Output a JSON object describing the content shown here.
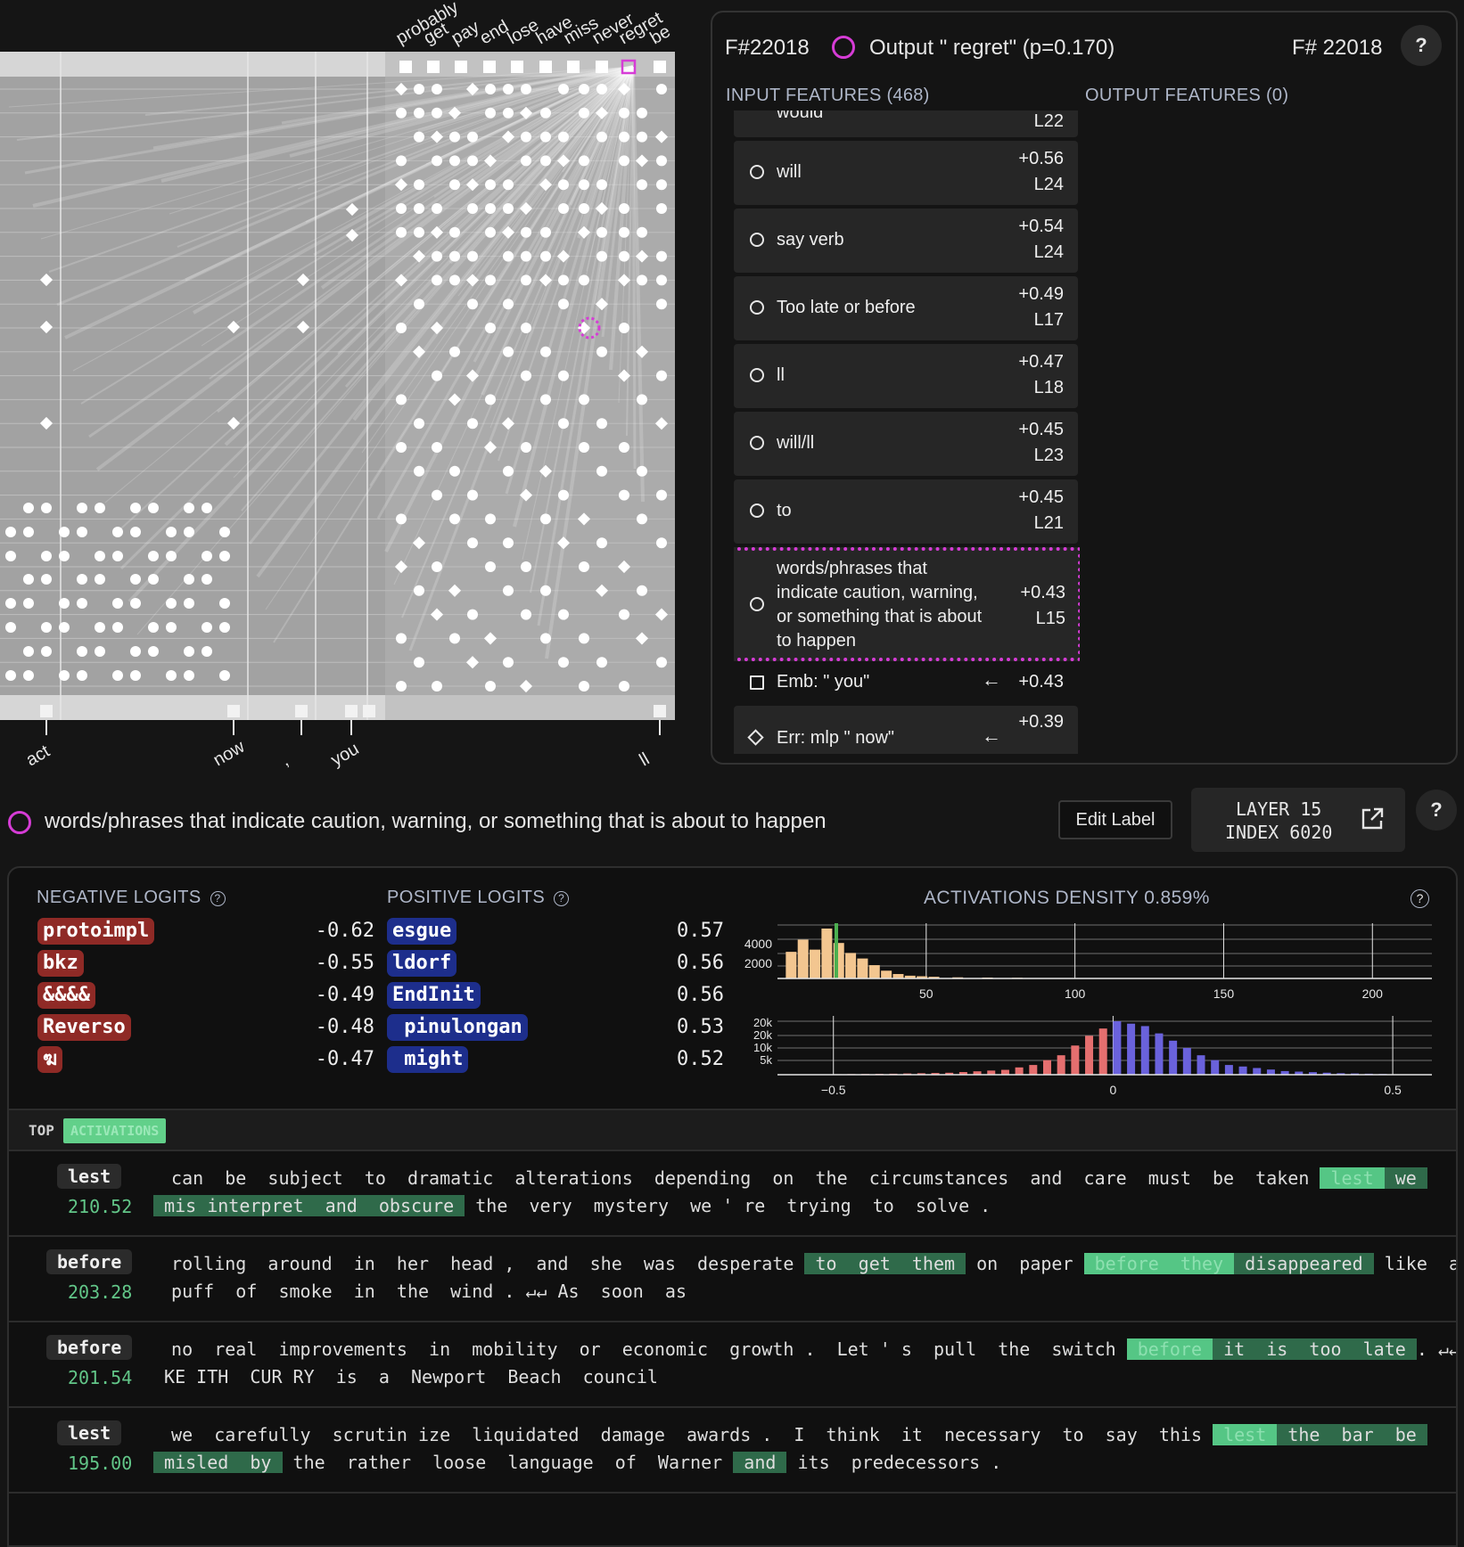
{
  "graph": {
    "top_tokens": [
      "probably",
      "get",
      "pay",
      "end",
      "lose",
      "have",
      "miss",
      "never",
      "regret",
      "be"
    ],
    "bottom_tokens": [
      "act",
      "now",
      ",",
      "you",
      "ll"
    ]
  },
  "node_panel": {
    "id_left": "F#22018",
    "title": "Output \" regret\" (p=0.170)",
    "id_right": "F# 22018",
    "help": "?",
    "input_features_label": "INPUT FEATURES (468)",
    "output_features_label": "OUTPUT FEATURES (0)",
    "partial_top": {
      "label": "would",
      "layer": "L22"
    },
    "features": [
      {
        "label": "will",
        "value": "+0.56",
        "layer": "L24",
        "icon": "circle"
      },
      {
        "label": "say verb",
        "value": "+0.54",
        "layer": "L24",
        "icon": "circle"
      },
      {
        "label": "Too late or before",
        "value": "+0.49",
        "layer": "L17",
        "icon": "circle"
      },
      {
        "label": "ll",
        "value": "+0.47",
        "layer": "L18",
        "icon": "circle"
      },
      {
        "label": "will/ll",
        "value": "+0.45",
        "layer": "L23",
        "icon": "circle"
      },
      {
        "label": "to",
        "value": "+0.45",
        "layer": "L21",
        "icon": "circle"
      }
    ],
    "selected_feature": {
      "lines": [
        "words/phrases that",
        "indicate caution, warning,",
        "or something that is about",
        "to happen"
      ],
      "value": "+0.43",
      "layer": "L15"
    },
    "emb_feature": {
      "label": "Emb: \" you\"",
      "arrow": "←",
      "value": "+0.43"
    },
    "err_feature": {
      "label": "Err: mlp \" now\"",
      "arrow": "←",
      "value": "+0.39"
    }
  },
  "feature_bar": {
    "label": "words/phrases that indicate caution, warning, or something that is about to happen",
    "edit_label": "Edit Label",
    "layer_line": "LAYER 15",
    "index_line": "INDEX 6020",
    "help": "?"
  },
  "logits": {
    "negative_header": "NEGATIVE LOGITS",
    "positive_header": "POSITIVE LOGITS",
    "negative": [
      {
        "token": "protoimpl",
        "value": "-0.62"
      },
      {
        "token": "bkz",
        "value": "-0.55"
      },
      {
        "token": "&&&&",
        "value": "-0.49"
      },
      {
        "token": "Reverso",
        "value": "-0.48"
      },
      {
        "token": "ฆ",
        "value": "-0.47"
      }
    ],
    "positive": [
      {
        "token": "esgue",
        "value": "0.57"
      },
      {
        "token": "ldorf",
        "value": "0.56"
      },
      {
        "token": "EndInit",
        "value": "0.56"
      },
      {
        "token": " pinulongan",
        "value": "0.53"
      },
      {
        "token": " might",
        "value": "0.52"
      }
    ]
  },
  "density": {
    "title": "ACTIVATIONS DENSITY 0.859%",
    "hist_top_y_ticks": [
      "4000",
      "2000"
    ],
    "hist_top_x_ticks": [
      "50",
      "100",
      "150",
      "200"
    ],
    "hist_bottom_y_ticks": [
      "20k",
      "20k",
      "10k",
      "5k"
    ],
    "hist_bottom_x_ticks": [
      "−0.5",
      "0",
      "0.5"
    ],
    "colors": {
      "top": "#f3c690",
      "neg": "#e56f6f",
      "pos": "#6a62dc",
      "marker": "#4caf50"
    }
  },
  "chart_data": [
    {
      "type": "bar",
      "title": "ACTIVATIONS DENSITY 0.859%",
      "x": [
        4,
        8,
        12,
        16,
        20,
        24,
        28,
        32,
        36,
        40,
        44,
        48,
        52,
        60,
        70,
        80,
        100,
        150,
        200
      ],
      "values": [
        2400,
        3500,
        2600,
        4500,
        3200,
        2300,
        1800,
        1200,
        700,
        400,
        250,
        200,
        150,
        100,
        80,
        60,
        40,
        25,
        15
      ],
      "xlim": [
        0,
        220
      ],
      "ylim": [
        0,
        4500
      ]
    },
    {
      "type": "bar",
      "x": [
        -0.5,
        -0.4,
        -0.3,
        -0.2,
        -0.15,
        -0.1,
        -0.05,
        0,
        0.05,
        0.1,
        0.15,
        0.2,
        0.3,
        0.4,
        0.5
      ],
      "values": [
        200,
        400,
        800,
        2000,
        4000,
        8000,
        16000,
        22000,
        20000,
        14000,
        8000,
        4000,
        1500,
        600,
        200
      ],
      "xlim": [
        -0.6,
        0.57
      ]
    }
  ],
  "top_activations": {
    "title": "TOP",
    "badge": "ACTIVATIONS",
    "examples": [
      {
        "token": "lest",
        "score": "210.52"
      },
      {
        "token": "before",
        "score": "203.28"
      },
      {
        "token": "before",
        "score": "201.54"
      },
      {
        "token": "lest",
        "score": "195.00"
      }
    ]
  }
}
